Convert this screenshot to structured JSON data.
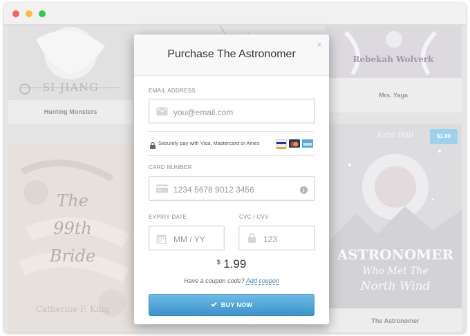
{
  "window": {
    "traffic_lights": [
      "close",
      "minimize",
      "zoom"
    ]
  },
  "store": {
    "books": [
      {
        "title": "Hunting Monsters",
        "cover_text": "SI JIANG"
      },
      {
        "title": "Mrs. Yaga",
        "cover_text": "Rebekah Wolverk"
      },
      {
        "title": "The 99th Bride",
        "cover_text_lines": [
          "The",
          "99th",
          "Bride"
        ],
        "author": "Catherine F. King"
      },
      {
        "title": "The Astronomer",
        "price": "$1.99",
        "author": "Kate Hall",
        "cover_text_lines": [
          "ASTRONOMER",
          "Who Met The",
          "North Wind"
        ]
      }
    ]
  },
  "modal": {
    "title": "Purchase The Astronomer",
    "close_glyph": "×",
    "email": {
      "label": "EMAIL ADDRESS",
      "placeholder": "you@email.com"
    },
    "secure_text": "Securely pay with Visa, Mastercard or Amex",
    "card_icons": [
      "visa-icon",
      "mastercard-icon",
      "amex-icon"
    ],
    "card_number": {
      "label": "CARD NUMBER",
      "placeholder": "1234 5678 9012 3456"
    },
    "expiry": {
      "label": "EXPIRY DATE",
      "placeholder": "MM / YY"
    },
    "cvc": {
      "label": "CVC / CVV",
      "placeholder": "123"
    },
    "price": {
      "currency": "$",
      "amount": "1.99"
    },
    "coupon": {
      "prompt": "Have a coupon code?",
      "link": "Add coupon"
    },
    "buy_button": "BUY NOW"
  },
  "colors": {
    "accent": "#4aa3d8",
    "link": "#3b7ec2",
    "price_tag": "#5fb6e3"
  }
}
